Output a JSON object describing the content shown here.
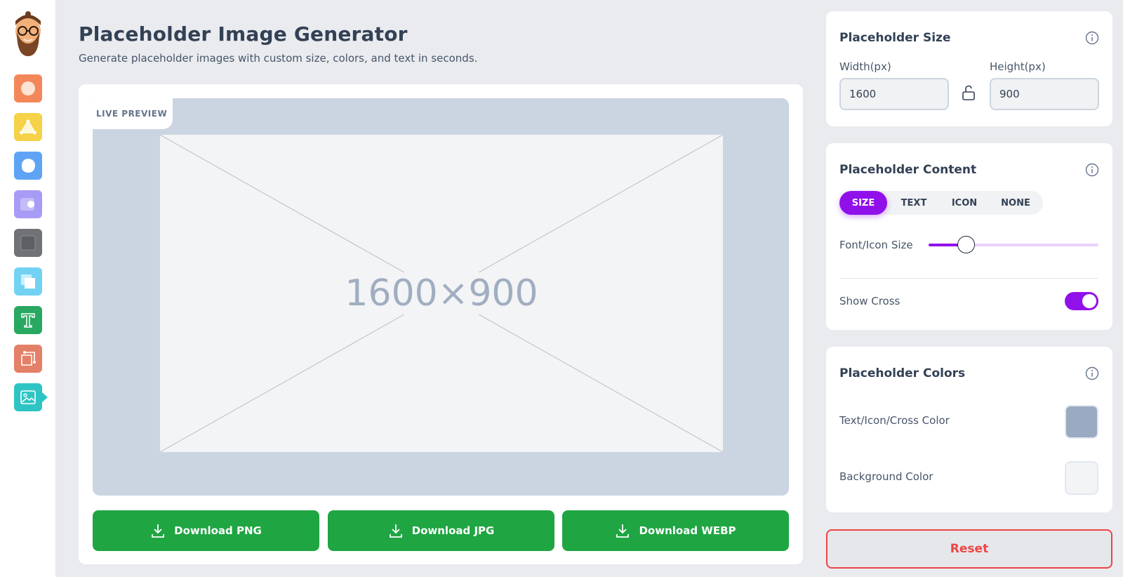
{
  "header": {
    "title": "Placeholder Image Generator",
    "subtitle": "Generate placeholder images with custom size, colors, and text in seconds."
  },
  "sidebar": {
    "avatar_icon": "bearded-man-avatar-icon",
    "tools": [
      {
        "icon": "gradient-icon",
        "color": "#f4875a"
      },
      {
        "icon": "shapes-icon",
        "color": "#f5d247"
      },
      {
        "icon": "blob-icon",
        "color": "#5fa3f5"
      },
      {
        "icon": "toggle-shape-icon",
        "color": "#a79cf5"
      },
      {
        "icon": "square-shadow-icon",
        "color": "#707275"
      },
      {
        "icon": "layers-icon",
        "color": "#73d2f3"
      },
      {
        "icon": "typography-icon",
        "color": "#28a860"
      },
      {
        "icon": "clip-path-icon",
        "color": "#e48067"
      },
      {
        "icon": "image-icon",
        "color": "#2ec4c4",
        "active": true
      }
    ]
  },
  "preview": {
    "tab_label": "LIVE PREVIEW",
    "placeholder_text": "1600×900"
  },
  "downloads": [
    {
      "label": "Download PNG"
    },
    {
      "label": "Download JPG"
    },
    {
      "label": "Download WEBP"
    }
  ],
  "size_panel": {
    "title": "Placeholder Size",
    "width_label": "Width(px)",
    "width_value": "1600",
    "height_label": "Height(px)",
    "height_value": "900",
    "lock_icon": "unlock-icon"
  },
  "content_panel": {
    "title": "Placeholder Content",
    "tabs": [
      "SIZE",
      "TEXT",
      "ICON",
      "NONE"
    ],
    "active_tab": "SIZE",
    "font_size_label": "Font/Icon Size",
    "font_size_fraction": 0.22,
    "show_cross_label": "Show Cross",
    "show_cross": true
  },
  "colors_panel": {
    "title": "Placeholder Colors",
    "text_color_label": "Text/Icon/Cross Color",
    "text_color": "#9aaac2",
    "background_label": "Background Color",
    "background_color": "#f3f4f6"
  },
  "reset_label": "Reset",
  "colors": {
    "accent": "#9111ea",
    "download": "#1fa542",
    "reset": "#ef4444"
  }
}
